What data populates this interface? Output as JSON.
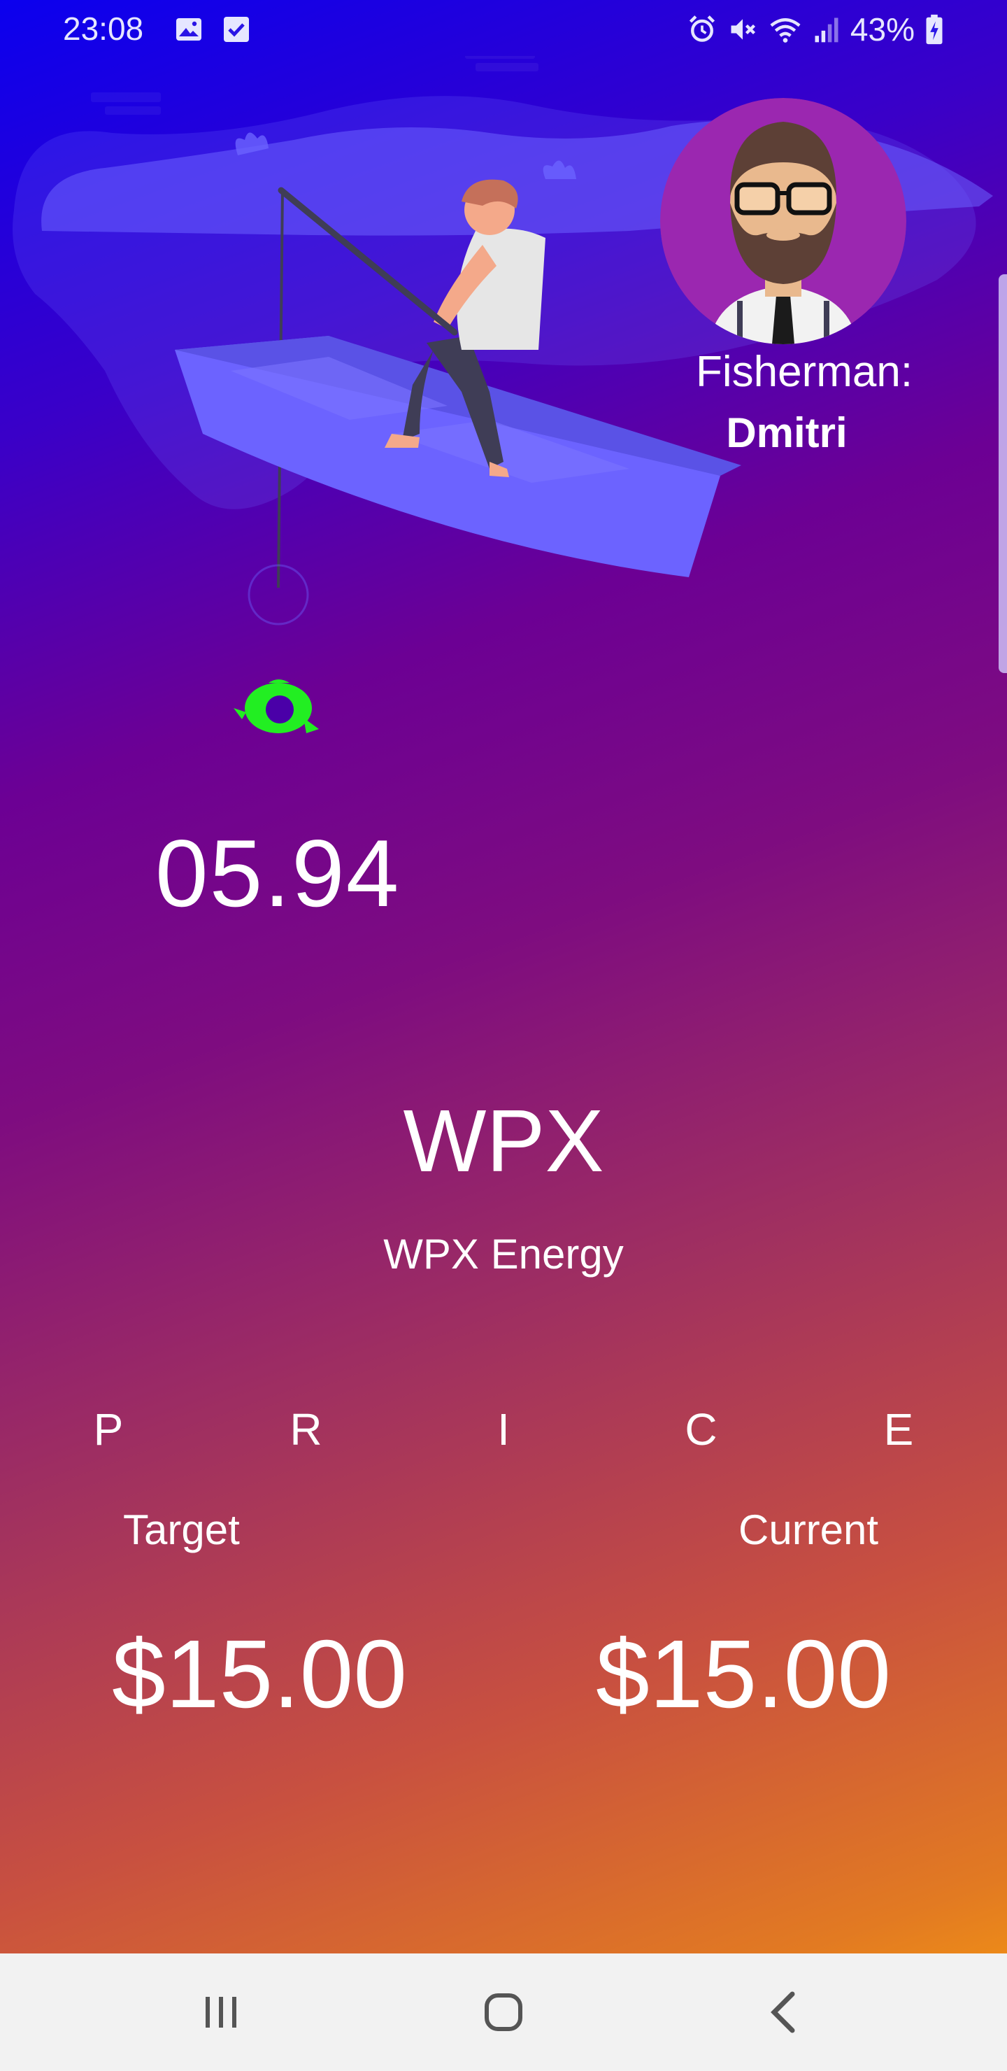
{
  "status_bar": {
    "time": "23:08",
    "battery_percent": "43%",
    "left_icons": [
      "image-icon",
      "check-box-icon"
    ],
    "right_icons": [
      "alarm-icon",
      "mute-icon",
      "wifi-icon",
      "signal-icon",
      "battery-charging-icon"
    ]
  },
  "fisherman": {
    "label": "Fisherman:",
    "name": "Dmitri"
  },
  "timer": {
    "value": "05.94"
  },
  "stock": {
    "ticker": "WPX",
    "company": "WPX Energy"
  },
  "price": {
    "letters": [
      "P",
      "R",
      "I",
      "C",
      "E"
    ],
    "target_label": "Target",
    "current_label": "Current",
    "target_value": "$15.00",
    "current_value": "$15.00"
  },
  "nav": {
    "buttons": [
      "recent-apps-icon",
      "home-icon",
      "back-icon"
    ]
  },
  "colors": {
    "gradient_top": "#0b00ee",
    "gradient_middle": "#7e0c80",
    "gradient_bottom": "#fba00c",
    "fish_green": "#22ee22",
    "avatar_bg": "#9b27b0",
    "boat": "#6c63ff"
  }
}
